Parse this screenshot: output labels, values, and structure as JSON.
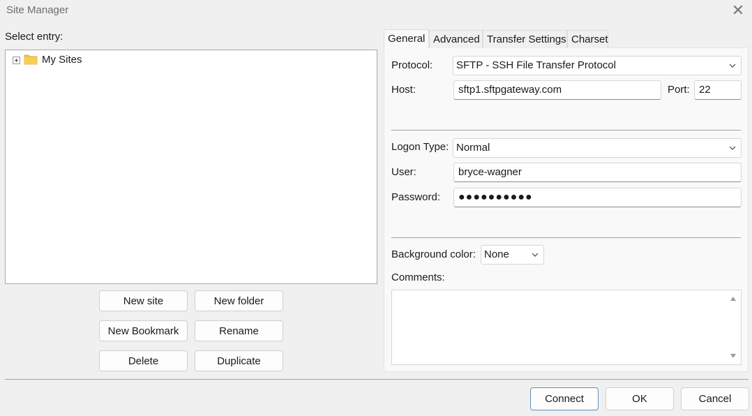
{
  "window": {
    "title": "Site Manager",
    "close_glyph": "✕"
  },
  "left": {
    "select_entry_label": "Select entry:",
    "tree": [
      {
        "label": "My Sites",
        "icon": "folder-icon",
        "expanded": false
      }
    ],
    "buttons": {
      "new_site": "New site",
      "new_folder": "New folder",
      "new_bookmark": "New Bookmark",
      "rename": "Rename",
      "delete": "Delete",
      "duplicate": "Duplicate"
    }
  },
  "tabs": [
    {
      "label": "General",
      "active": true
    },
    {
      "label": "Advanced",
      "active": false
    },
    {
      "label": "Transfer Settings",
      "active": false
    },
    {
      "label": "Charset",
      "active": false
    }
  ],
  "general": {
    "protocol_label": "Protocol:",
    "protocol_value": "SFTP - SSH File Transfer Protocol",
    "host_label": "Host:",
    "host_value": "sftp1.sftpgateway.com",
    "port_label": "Port:",
    "port_value": "22",
    "logon_type_label": "Logon Type:",
    "logon_type_value": "Normal",
    "user_label": "User:",
    "user_value": "bryce-wagner",
    "password_label": "Password:",
    "password_value": "●●●●●●●●●●",
    "background_color_label": "Background color:",
    "background_color_value": "None",
    "comments_label": "Comments:",
    "comments_value": ""
  },
  "footer": {
    "connect": "Connect",
    "ok": "OK",
    "cancel": "Cancel"
  },
  "colors": {
    "folder": "#f5c242",
    "primary_border": "#5e8fbe",
    "panel": "#f9f9f9",
    "window": "#f0f0f0"
  }
}
